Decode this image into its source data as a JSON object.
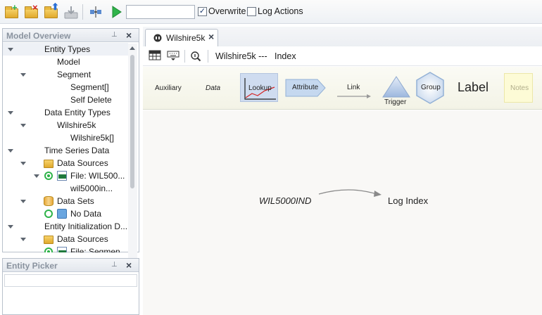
{
  "toolbar": {
    "input_value": "",
    "overwrite_label": "Overwrite",
    "overwrite_checked": true,
    "log_actions_label": "Log Actions",
    "log_actions_checked": false,
    "check_glyph": "✓"
  },
  "model_overview": {
    "title": "Model Overview",
    "pin_glyph": "⊥",
    "close_glyph": "×",
    "tree": [
      {
        "label": "Entity Types",
        "arrow": true,
        "icon": ""
      },
      {
        "label": "Model",
        "arrow": false,
        "icon": ""
      },
      {
        "label": "Segment",
        "arrow": true,
        "icon": ""
      },
      {
        "label": "Segment[]",
        "arrow": false,
        "icon": ""
      },
      {
        "label": "Self Delete",
        "arrow": false,
        "icon": ""
      },
      {
        "label": "Data Entity Types",
        "arrow": true,
        "icon": ""
      },
      {
        "label": "Wilshire5k",
        "arrow": true,
        "icon": ""
      },
      {
        "label": "Wilshire5k[]",
        "arrow": false,
        "icon": ""
      },
      {
        "label": "Time Series Data",
        "arrow": true,
        "icon": ""
      },
      {
        "label": "Data Sources",
        "arrow": true,
        "icon": "folder-icon"
      },
      {
        "label": "File: WIL500...",
        "arrow": true,
        "icon": "xlsx-file-icon"
      },
      {
        "label": "wil5000in...",
        "arrow": false,
        "icon": ""
      },
      {
        "label": "Data Sets",
        "arrow": true,
        "icon": "database-icon"
      },
      {
        "label": "No Data",
        "arrow": false,
        "icon": "dataset-icon"
      },
      {
        "label": "Entity Initialization D...",
        "arrow": true,
        "icon": ""
      },
      {
        "label": "Data Sources",
        "arrow": true,
        "icon": "folder-icon"
      },
      {
        "label": "File: Segmen...",
        "arrow": false,
        "icon": "xlsx-file-icon"
      }
    ]
  },
  "entity_picker": {
    "title": "Entity Picker",
    "pin_glyph": "⊥",
    "close_glyph": "×"
  },
  "document": {
    "tab_label": "Wilshire5k",
    "tab_close": "×",
    "breadcrumb_model": "Wilshire5k ---",
    "breadcrumb_view": "Index"
  },
  "palette": {
    "auxiliary": "Auxiliary",
    "data": "Data",
    "lookup": "Lookup",
    "attribute": "Attribute",
    "link": "Link",
    "trigger": "Trigger",
    "group": "Group",
    "label": "Label",
    "notes": "Notes"
  },
  "canvas": {
    "source_node": "WIL5000IND",
    "target_node": "Log Index"
  },
  "colors": {
    "accent_green": "#2fb34a",
    "folder_yellow": "#e8b840",
    "selection_blue": "#cfdcf0"
  }
}
